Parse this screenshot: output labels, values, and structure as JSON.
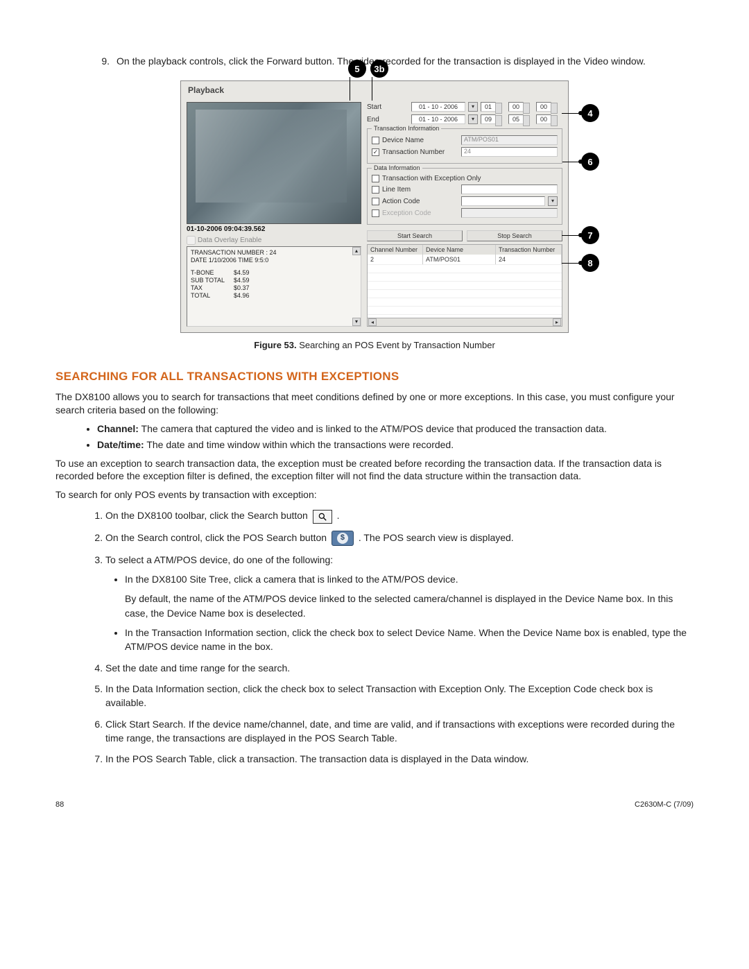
{
  "step9": {
    "num": "9.",
    "text": "On the playback controls, click the Forward button. The video recorded for the transaction is displayed in the Video window."
  },
  "callouts": {
    "top1": "5",
    "top2": "3b",
    "r1": "4",
    "r2": "6",
    "r3": "7",
    "r4": "8"
  },
  "playback": {
    "title": "Playback",
    "timestamp": "01-10-2006 09:04:39.562",
    "overlay_label": "Data Overlay Enable",
    "receipt": {
      "line1": "TRANSACTION NUMBER : 24",
      "line2": "DATE 1/10/2006    TIME 9:5:0",
      "items": [
        {
          "name": "T-BONE",
          "amt": "$4.59"
        },
        {
          "name": "SUB TOTAL",
          "amt": "$4.59"
        },
        {
          "name": "TAX",
          "amt": "$0.37"
        },
        {
          "name": "TOTAL",
          "amt": "$4.96"
        }
      ]
    },
    "start_label": "Start",
    "end_label": "End",
    "date_start": "01 - 10 - 2006",
    "date_end": "01 - 10 - 2006",
    "time_start": [
      "01",
      "00",
      "00"
    ],
    "time_end": [
      "09",
      "05",
      "00"
    ],
    "ti_legend": "Transaction Information",
    "device_name_label": "Device Name",
    "device_name_value": "ATM/POS01",
    "trans_num_label": "Transaction Number",
    "trans_num_value": "24",
    "di_legend": "Data Information",
    "exc_only_label": "Transaction with Exception Only",
    "line_item_label": "Line Item",
    "action_code_label": "Action Code",
    "exception_code_label": "Exception Code",
    "start_search": "Start Search",
    "stop_search": "Stop Search",
    "table": {
      "h1": "Channel Number",
      "h2": "Device Name",
      "h3": "Transaction Number",
      "r1c1": "2",
      "r1c2": "ATM/POS01",
      "r1c3": "24"
    }
  },
  "caption": {
    "bold": "Figure 53.",
    "rest": "  Searching an POS Event by Transaction Number"
  },
  "heading": "SEARCHING FOR ALL TRANSACTIONS WITH EXCEPTIONS",
  "para1": "The DX8100 allows you to search for transactions that meet conditions defined by one or more exceptions. In this case, you must configure your search criteria based on the following:",
  "bullets": {
    "b1_bold": "Channel:",
    "b1": " The camera that captured the video and is linked to the ATM/POS device that produced the transaction data.",
    "b2_bold": "Date/time:",
    "b2": " The date and time window within which the transactions were recorded."
  },
  "para2": "To use an exception to search transaction data, the exception must be created before recording the transaction data. If the transaction data is recorded before the exception filter is defined, the exception filter will not find the data structure within the transaction data.",
  "para3": "To search for only POS events by transaction with exception:",
  "steps": {
    "s1a": "On the DX8100 toolbar, click the Search button ",
    "s1b": " .",
    "s2a": "On the Search control, click the POS Search button ",
    "s2b": " . The POS search view is displayed.",
    "s3": "To select a ATM/POS device, do one of the following:",
    "s3a": "In the DX8100 Site Tree, click a camera that is linked to the ATM/POS device.",
    "s3a2": "By default, the name of the ATM/POS device linked to the selected camera/channel is displayed in the Device Name box. In this case, the Device Name box is deselected.",
    "s3b": "In the Transaction Information section, click the check box to select Device Name. When the Device Name box is enabled, type the ATM/POS device name in the box.",
    "s4": "Set the date and time range for the search.",
    "s5": "In the Data Information section, click the check box to select Transaction with Exception Only. The Exception Code check box is available.",
    "s6": "Click Start Search. If the device name/channel, date, and time are valid, and if transactions with exceptions were recorded during the time range, the transactions are displayed in the POS Search Table.",
    "s7": "In the POS Search Table, click a transaction. The transaction data is displayed in the Data window."
  },
  "footer": {
    "page": "88",
    "doc": "C2630M-C (7/09)"
  }
}
